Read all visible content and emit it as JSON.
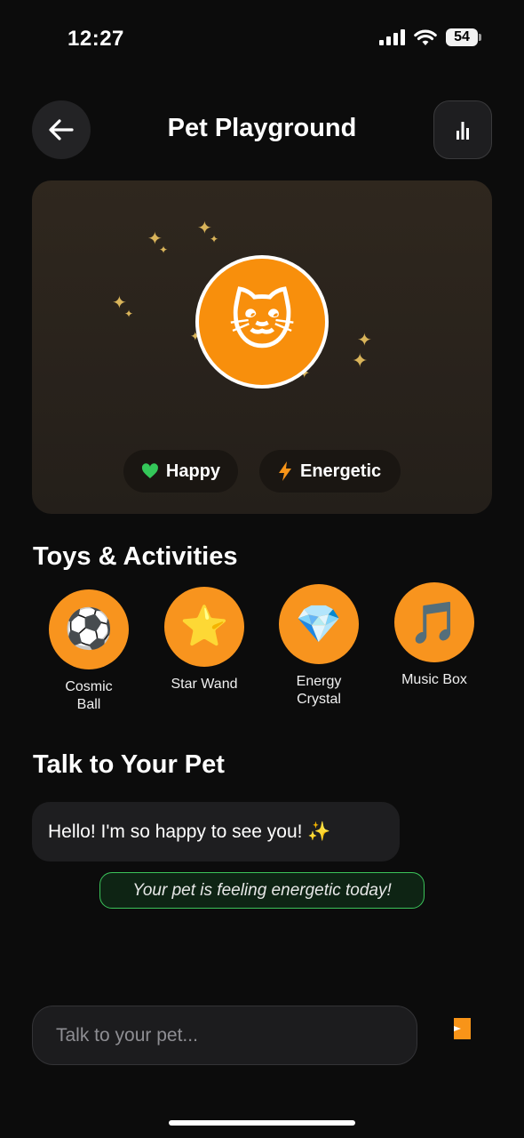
{
  "status_bar": {
    "time": "12:27",
    "battery": "54"
  },
  "header": {
    "title": "Pet Playground",
    "back_icon": "arrow-left-icon",
    "stats_icon": "bar-chart-icon"
  },
  "pet": {
    "avatar_emoji": "🐱",
    "moods": [
      {
        "label": "Happy",
        "icon": "💚",
        "color": "#34c759"
      },
      {
        "label": "Energetic",
        "icon": "⚡",
        "color": "#f89418"
      }
    ]
  },
  "toys": {
    "title": "Toys & Activities",
    "items": [
      {
        "label": "Cosmic Ball",
        "emoji": "⚽"
      },
      {
        "label": "Star Wand",
        "emoji": "⭐"
      },
      {
        "label": "Energy Crystal",
        "emoji": "💎"
      },
      {
        "label": "Music Box",
        "emoji": "🎵"
      }
    ]
  },
  "chat": {
    "title": "Talk to Your Pet",
    "pet_message": "Hello! I'm so happy to see you! ✨",
    "status_message": "Your pet is feeling energetic today!",
    "input_placeholder": "Talk to your pet..."
  },
  "colors": {
    "accent": "#f89418",
    "background": "#0c0c0c",
    "status_border": "#3bc45a"
  }
}
